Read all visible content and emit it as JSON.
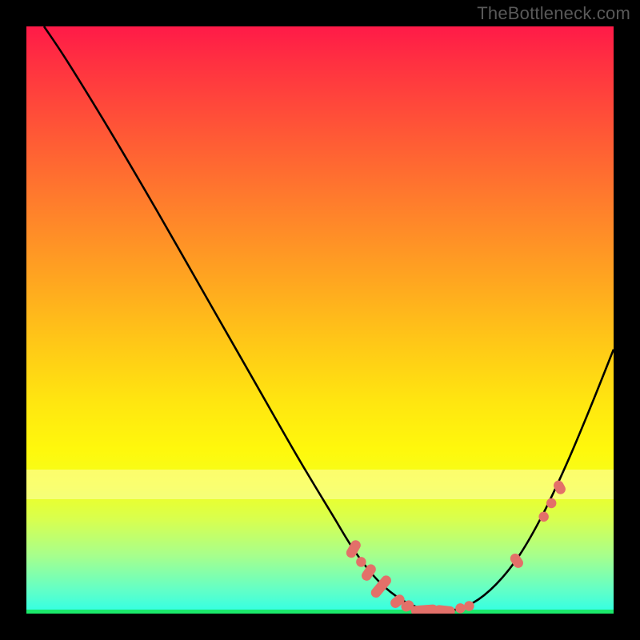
{
  "attribution": "TheBottleneck.com",
  "chart_data": {
    "type": "line",
    "title": "",
    "xlabel": "",
    "ylabel": "",
    "xlim": [
      0,
      100
    ],
    "ylim": [
      0,
      100
    ],
    "curve": [
      {
        "x": 3.0,
        "y": 100.0
      },
      {
        "x": 7.0,
        "y": 94.0
      },
      {
        "x": 14.0,
        "y": 82.6
      },
      {
        "x": 22.0,
        "y": 69.0
      },
      {
        "x": 30.0,
        "y": 55.0
      },
      {
        "x": 38.0,
        "y": 41.0
      },
      {
        "x": 46.0,
        "y": 27.0
      },
      {
        "x": 52.0,
        "y": 17.0
      },
      {
        "x": 56.0,
        "y": 10.5
      },
      {
        "x": 60.0,
        "y": 5.5
      },
      {
        "x": 64.0,
        "y": 2.3
      },
      {
        "x": 68.0,
        "y": 0.7
      },
      {
        "x": 72.0,
        "y": 0.5
      },
      {
        "x": 76.0,
        "y": 1.8
      },
      {
        "x": 80.0,
        "y": 5.0
      },
      {
        "x": 84.0,
        "y": 10.0
      },
      {
        "x": 88.0,
        "y": 17.0
      },
      {
        "x": 92.0,
        "y": 25.5
      },
      {
        "x": 96.0,
        "y": 35.0
      },
      {
        "x": 100.0,
        "y": 45.0
      }
    ],
    "markers": [
      {
        "x": 55.7,
        "y": 11.0,
        "type": "pill",
        "len": 3.2,
        "angle": -60
      },
      {
        "x": 57.0,
        "y": 8.8,
        "type": "dot"
      },
      {
        "x": 58.3,
        "y": 7.0,
        "type": "pill",
        "len": 3.0,
        "angle": -56
      },
      {
        "x": 60.4,
        "y": 4.6,
        "type": "pill",
        "len": 4.4,
        "angle": -50
      },
      {
        "x": 63.2,
        "y": 2.1,
        "type": "pill",
        "len": 2.6,
        "angle": -40
      },
      {
        "x": 64.9,
        "y": 1.3,
        "type": "pill",
        "len": 2.2,
        "angle": -25
      },
      {
        "x": 67.8,
        "y": 0.6,
        "type": "pill",
        "len": 4.6,
        "angle": -4
      },
      {
        "x": 71.2,
        "y": 0.5,
        "type": "pill",
        "len": 3.6,
        "angle": 6
      },
      {
        "x": 73.9,
        "y": 0.9,
        "type": "dot"
      },
      {
        "x": 75.4,
        "y": 1.3,
        "type": "dot"
      },
      {
        "x": 83.5,
        "y": 9.0,
        "type": "pill",
        "len": 2.6,
        "angle": 56
      },
      {
        "x": 88.1,
        "y": 16.5,
        "type": "dot"
      },
      {
        "x": 89.4,
        "y": 18.8,
        "type": "dot"
      },
      {
        "x": 90.8,
        "y": 21.5,
        "type": "pill",
        "len": 2.4,
        "angle": 62
      }
    ],
    "gradient_stops": [
      {
        "pct": 0,
        "color": "#ff1a48"
      },
      {
        "pct": 50,
        "color": "#ffc817"
      },
      {
        "pct": 100,
        "color": "#2fffe6"
      }
    ]
  }
}
